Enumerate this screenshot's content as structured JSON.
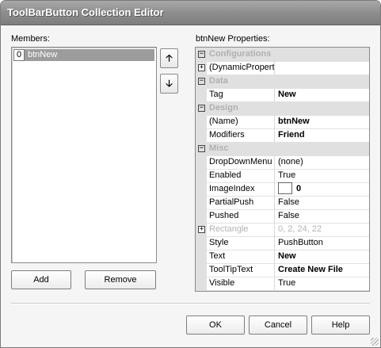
{
  "window": {
    "title": "ToolBarButton Collection Editor"
  },
  "members": {
    "label": "Members:",
    "items": [
      {
        "index": "0",
        "name": "btnNew"
      }
    ],
    "move_up_icon": "arrow-up-icon",
    "move_down_icon": "arrow-down-icon",
    "add_label": "Add",
    "remove_label": "Remove"
  },
  "properties": {
    "label": "btnNew Properties:",
    "rows": [
      {
        "type": "category",
        "name": "Configurations",
        "expander": "minus"
      },
      {
        "type": "prop",
        "name": "(DynamicPropertie",
        "value": "",
        "expander": "plus"
      },
      {
        "type": "category",
        "name": "Data",
        "expander": "minus"
      },
      {
        "type": "prop",
        "name": "Tag",
        "value": "New",
        "bold": true
      },
      {
        "type": "category",
        "name": "Design",
        "expander": "minus"
      },
      {
        "type": "prop",
        "name": "(Name)",
        "value": "btnNew",
        "bold": true
      },
      {
        "type": "prop",
        "name": "Modifiers",
        "value": "Friend",
        "bold": true
      },
      {
        "type": "category",
        "name": "Misc",
        "expander": "minus"
      },
      {
        "type": "prop",
        "name": "DropDownMenu",
        "value": "(none)"
      },
      {
        "type": "prop",
        "name": "Enabled",
        "value": "True"
      },
      {
        "type": "prop",
        "name": "ImageIndex",
        "value": "0",
        "bold": true,
        "image": true
      },
      {
        "type": "prop",
        "name": "PartialPush",
        "value": "False"
      },
      {
        "type": "prop",
        "name": "Pushed",
        "value": "False"
      },
      {
        "type": "prop",
        "name": "Rectangle",
        "value": "0, 2, 24, 22",
        "disabled": true,
        "expander": "plus"
      },
      {
        "type": "prop",
        "name": "Style",
        "value": "PushButton"
      },
      {
        "type": "prop",
        "name": "Text",
        "value": "New",
        "bold": true
      },
      {
        "type": "prop",
        "name": "ToolTipText",
        "value": "Create New File",
        "bold": true
      },
      {
        "type": "prop",
        "name": "Visible",
        "value": "True"
      }
    ]
  },
  "footer": {
    "ok_label": "OK",
    "cancel_label": "Cancel",
    "help_label": "Help"
  }
}
